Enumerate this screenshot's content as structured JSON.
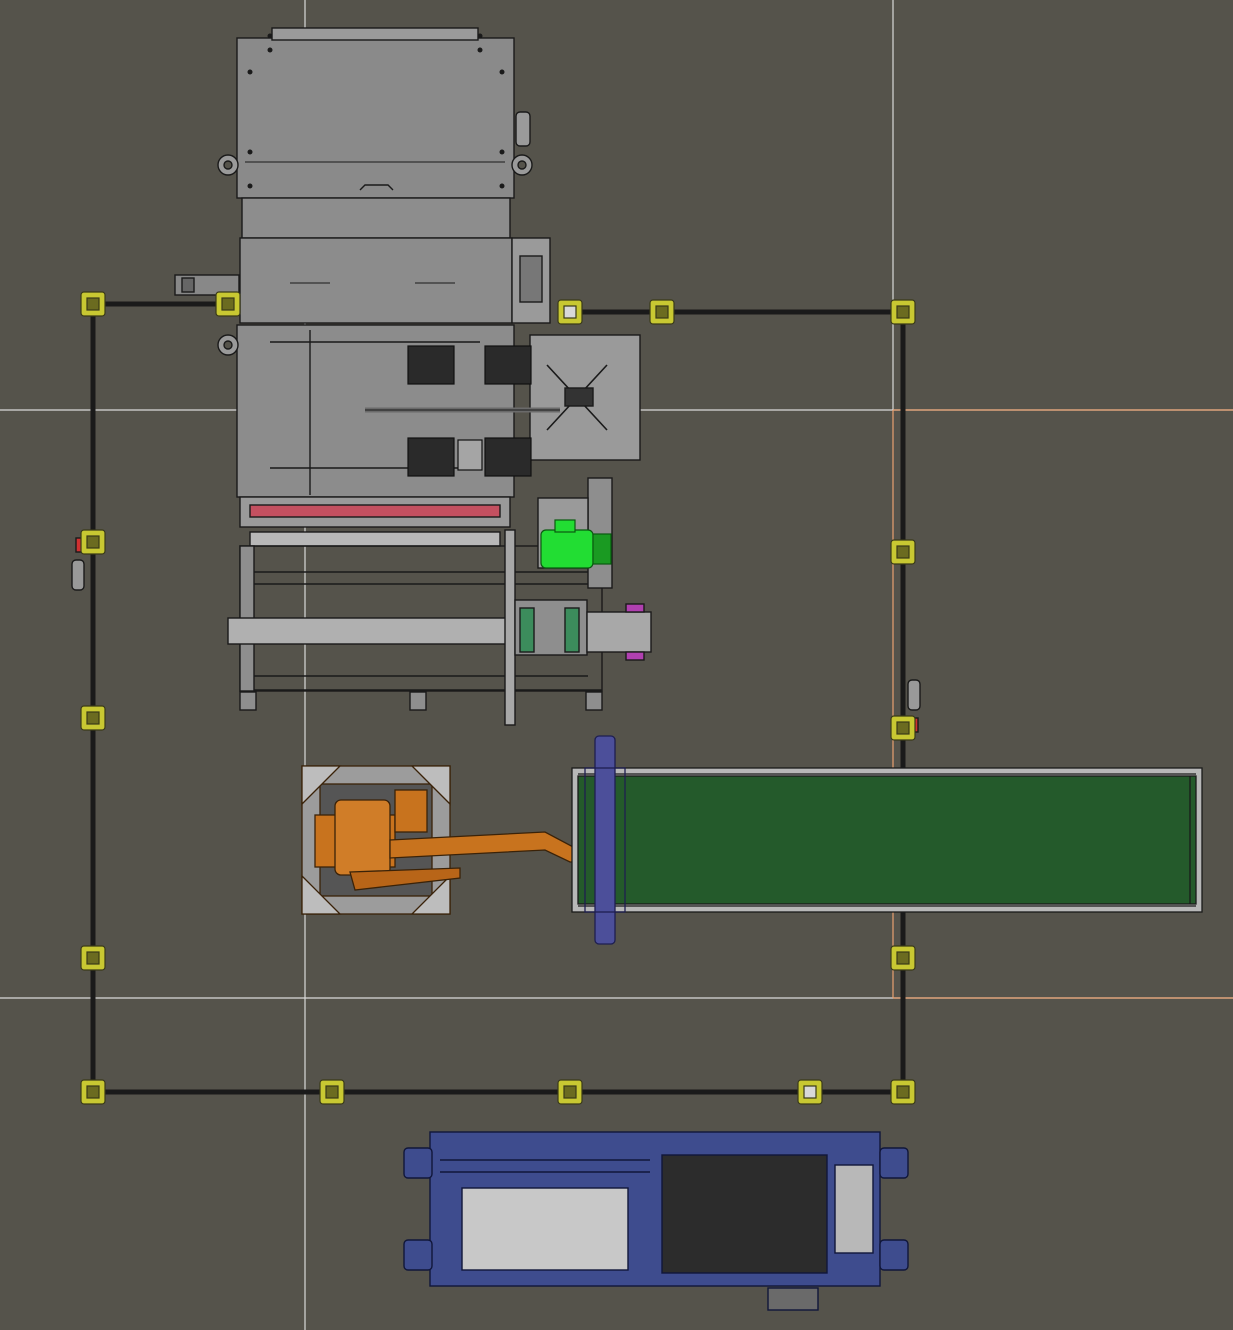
{
  "view": {
    "background_color": "#55534b",
    "grid_line_color": "#d9d9d9",
    "highlight_line_color": "#e8a070"
  },
  "components": [
    {
      "name": "hopper-feeder",
      "color": "#8a8a8a"
    },
    {
      "name": "gripper-station",
      "color": "#8c8c8c"
    },
    {
      "name": "drive-motor",
      "color": "#22dd33"
    },
    {
      "name": "roller-frame",
      "color": "#8e8e8e"
    },
    {
      "name": "industrial-robot-arm",
      "color": "#c8731e"
    },
    {
      "name": "belt-conveyor",
      "color": "#245a2b"
    },
    {
      "name": "transfer-chain",
      "color": "#4c4f9a"
    },
    {
      "name": "pallet-cart",
      "color": "#3e4c8e"
    },
    {
      "name": "safety-fence",
      "color": "#1a1a1a"
    },
    {
      "name": "fence-posts",
      "color": "#c8c832"
    }
  ]
}
